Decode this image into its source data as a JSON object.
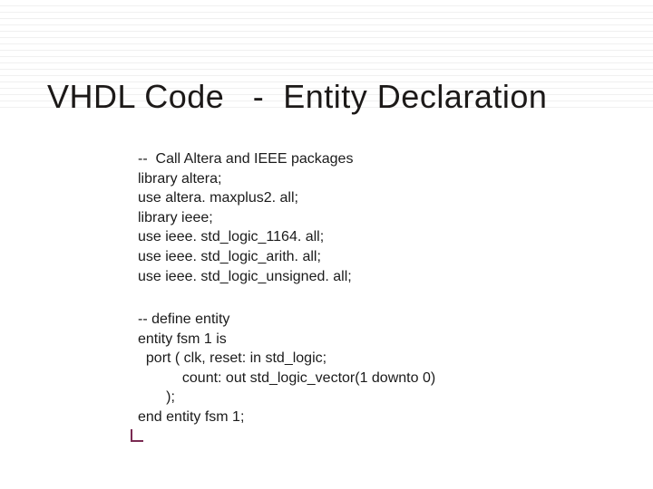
{
  "title": "VHDL Code   -  Entity Declaration",
  "code_block_1": "--  Call Altera and IEEE packages\nlibrary altera;\nuse altera. maxplus2. all;\nlibrary ieee;\nuse ieee. std_logic_1164. all;\nuse ieee. std_logic_arith. all;\nuse ieee. std_logic_unsigned. all;",
  "code_block_2": "-- define entity\nentity fsm 1 is\n  port ( clk, reset: in std_logic;\n           count: out std_logic_vector(1 downto 0)\n       );\nend entity fsm 1;"
}
